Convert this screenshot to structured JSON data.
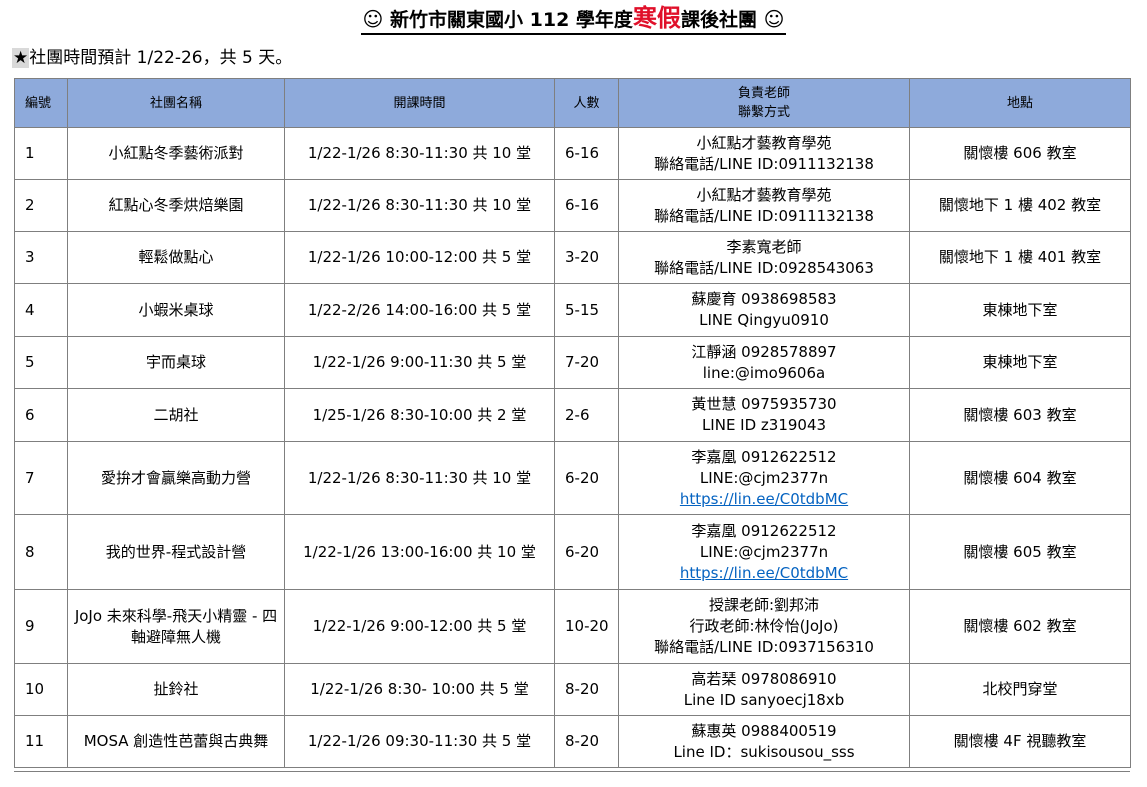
{
  "title": {
    "smile": "☺",
    "prefix": "新竹市關東國小 112 學年度",
    "highlight": "寒假",
    "suffix": "課後社團"
  },
  "subtitle": {
    "star": "★",
    "text": "社團時間預計 1/22-26，共 5 天。"
  },
  "table": {
    "headers": {
      "no": "編號",
      "name": "社團名稱",
      "time": "開課時間",
      "people": "人數",
      "teacher_line1": "負責老師",
      "teacher_line2": "聯繫方式",
      "place": "地點"
    },
    "rows": [
      {
        "no": "1",
        "name": "小紅點冬季藝術派對",
        "time": "1/22-1/26  8:30-11:30  共 10 堂",
        "people": "6-16",
        "contact": [
          "小紅點才藝教育學苑",
          "聯絡電話/LINE ID:0911132138"
        ],
        "place": "關懷樓 606 教室"
      },
      {
        "no": "2",
        "name": "紅點心冬季烘焙樂園",
        "time": "1/22-1/26  8:30-11:30  共 10 堂",
        "people": "6-16",
        "contact": [
          "小紅點才藝教育學苑",
          "聯絡電話/LINE ID:0911132138"
        ],
        "place": "關懷地下 1 樓 402 教室"
      },
      {
        "no": "3",
        "name": "輕鬆做點心",
        "time": "1/22-1/26  10:00-12:00  共 5 堂",
        "people": "3-20",
        "contact": [
          "李素寬老師",
          "聯絡電話/LINE ID:0928543063"
        ],
        "place": "關懷地下 1 樓 401 教室"
      },
      {
        "no": "4",
        "name": "小蝦米桌球",
        "time": "1/22-2/26  14:00-16:00  共 5 堂",
        "people": "5-15",
        "contact": [
          "蘇慶育 0938698583",
          "LINE  Qingyu0910"
        ],
        "place": "東棟地下室"
      },
      {
        "no": "5",
        "name": "宇而桌球",
        "time": "1/22-1/26  9:00-11:30 共 5 堂",
        "people": "7-20",
        "contact": [
          "江靜涵 0928578897",
          "line:@imo9606a"
        ],
        "place": "東棟地下室"
      },
      {
        "no": "6",
        "name": "二胡社",
        "time": "1/25-1/26  8:30-10:00 共 2 堂",
        "people": "2-6",
        "contact": [
          "黃世慧  0975935730",
          "LINE ID  z319043"
        ],
        "place": "關懷樓 603 教室"
      },
      {
        "no": "7",
        "name": "愛拚才會贏樂高動力營",
        "time": "1/22-1/26  8:30-11:30  共 10 堂",
        "people": "6-20",
        "contact": [
          "李嘉凰  0912622512",
          "LINE:@cjm2377n"
        ],
        "link": "https://lin.ee/C0tdbMC",
        "place": "關懷樓 604 教室"
      },
      {
        "no": "8",
        "name": "我的世界-程式設計營",
        "time": "1/22-1/26  13:00-16:00  共 10 堂",
        "people": "6-20",
        "contact": [
          "李嘉凰  0912622512",
          "LINE:@cjm2377n"
        ],
        "link": "https://lin.ee/C0tdbMC",
        "place": "關懷樓 605 教室"
      },
      {
        "no": "9",
        "name": "JoJo 未來科學-飛天小精靈 - 四軸避障無人機",
        "time": "1/22-1/26  9:00-12:00  共 5 堂",
        "people": "10-20",
        "contact": [
          "授課老師:劉邦沛",
          "行政老師:林伶怡(JoJo)",
          "聯絡電話/LINE ID:0937156310"
        ],
        "place": "關懷樓 602 教室"
      },
      {
        "no": "10",
        "name": "扯鈴社",
        "time": "1/22-1/26  8:30- 10:00  共 5 堂",
        "people": "8-20",
        "contact": [
          "高若琹  0978086910",
          "Line ID  sanyoecj18xb"
        ],
        "place": "北校門穿堂"
      },
      {
        "no": "11",
        "name": "MOSA 創造性芭蕾與古典舞",
        "time": "1/22-1/26 09:30-11:30 共 5 堂",
        "people": "8-20",
        "contact": [
          "蘇惠英 0988400519",
          "Line ID：sukisousou_sss"
        ],
        "place": "關懷樓 4F 視聽教室"
      }
    ]
  }
}
